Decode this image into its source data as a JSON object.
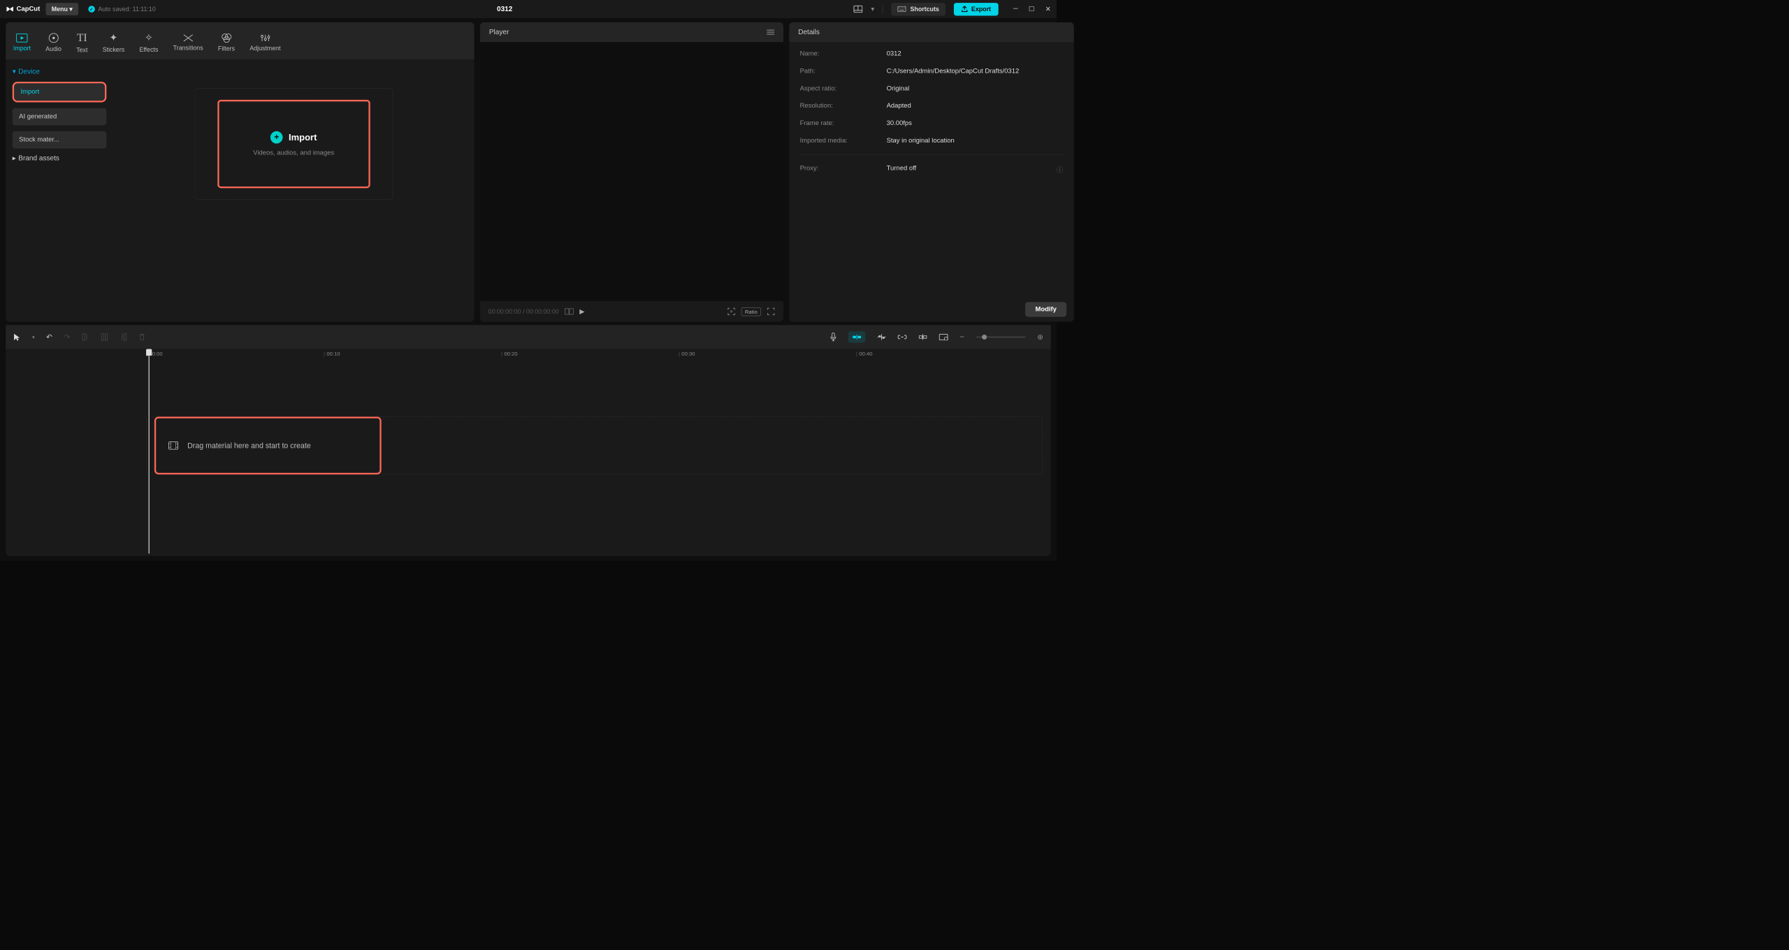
{
  "title": "0312",
  "app": {
    "name": "CapCut"
  },
  "menu_label": "Menu",
  "autosave": {
    "label": "Auto saved: 11:11:10"
  },
  "shortcuts_label": "Shortcuts",
  "export_label": "Export",
  "tabs": {
    "import": "Import",
    "audio": "Audio",
    "text": "Text",
    "stickers": "Stickers",
    "effects": "Effects",
    "transitions": "Transitions",
    "filters": "Filters",
    "adjustment": "Adjustment"
  },
  "sidebar": {
    "device": "Device",
    "import": "Import",
    "ai": "AI generated",
    "stock": "Stock mater...",
    "brand": "Brand assets"
  },
  "dropzone": {
    "title": "Import",
    "subtitle": "Videos, audios, and images"
  },
  "player": {
    "title": "Player",
    "current_time": "00:00:00:00",
    "total_time": "00:00:00:00",
    "ratio": "Ratio"
  },
  "details": {
    "title": "Details",
    "fields": {
      "name": {
        "label": "Name:",
        "value": "0312"
      },
      "path": {
        "label": "Path:",
        "value": "C:/Users/Admin/Desktop/CapCut Drafts/0312"
      },
      "aspect": {
        "label": "Aspect ratio:",
        "value": "Original"
      },
      "resolution": {
        "label": "Resolution:",
        "value": "Adapted"
      },
      "fps": {
        "label": "Frame rate:",
        "value": "30.00fps"
      },
      "imported": {
        "label": "Imported media:",
        "value": "Stay in original location"
      },
      "proxy": {
        "label": "Proxy:",
        "value": "Turned off"
      }
    },
    "modify": "Modify"
  },
  "timeline": {
    "marks": [
      "00:00",
      "00:10",
      "00:20",
      "00:30",
      "00:40"
    ],
    "drop_msg": "Drag material here and start to create"
  }
}
